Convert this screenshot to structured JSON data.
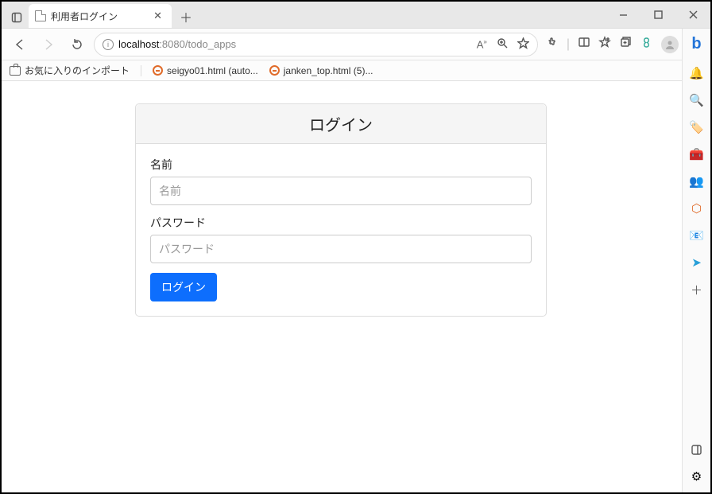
{
  "window": {
    "tab_title": "利用者ログイン"
  },
  "address_bar": {
    "host": "localhost",
    "port_path": ":8080/todo_apps"
  },
  "bookmarks": {
    "import_label": "お気に入りのインポート",
    "items": [
      {
        "label": "seigyo01.html (auto..."
      },
      {
        "label": "janken_top.html (5)..."
      }
    ]
  },
  "login": {
    "header": "ログイン",
    "name_label": "名前",
    "name_placeholder": "名前",
    "password_label": "パスワード",
    "password_placeholder": "パスワード",
    "submit_label": "ログイン"
  }
}
